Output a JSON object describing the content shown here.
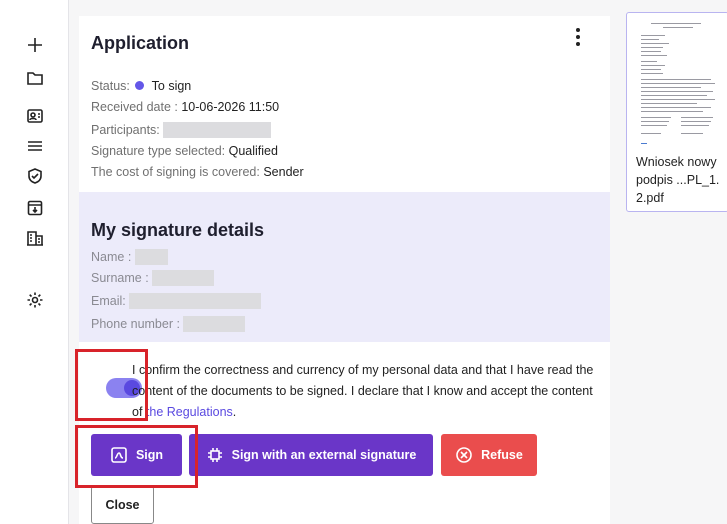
{
  "sidebar": {
    "icons": [
      "plus-icon",
      "folder-icon",
      "contact-card-icon",
      "list-icon",
      "shield-check-icon",
      "archive-icon",
      "building-icon",
      "gear-icon"
    ]
  },
  "application": {
    "title": "Application",
    "status_label": "Status:",
    "status_value": "To sign",
    "status_color": "#6457e8",
    "received_label": "Received date :",
    "received_value": "10-06-2026 11:50",
    "participants_label": "Participants:",
    "signature_type_label": "Signature type selected:",
    "signature_type_value": "Qualified",
    "cost_label": "The cost of signing is covered:",
    "cost_value": "Sender"
  },
  "signature_details": {
    "title": "My signature details",
    "name_label": "Name :",
    "surname_label": "Surname :",
    "email_label": "Email:",
    "phone_label": "Phone number :"
  },
  "consent": {
    "text": "I confirm the correctness and currency of my personal data and that I have read the content of the documents to be signed. I declare that I know and accept the content of ",
    "link": "the Regulations",
    "end": ".",
    "checked": true
  },
  "buttons": {
    "sign": "Sign",
    "sign_external": "Sign with an external signature",
    "refuse": "Refuse",
    "close": "Close"
  },
  "document": {
    "name": "Wniosek nowy podpis ...PL_1. 2.pdf"
  },
  "colors": {
    "primary": "#6a36c8",
    "danger": "#ea4d4d",
    "panel": "#ecebfa",
    "highlight": "#d8232a"
  }
}
